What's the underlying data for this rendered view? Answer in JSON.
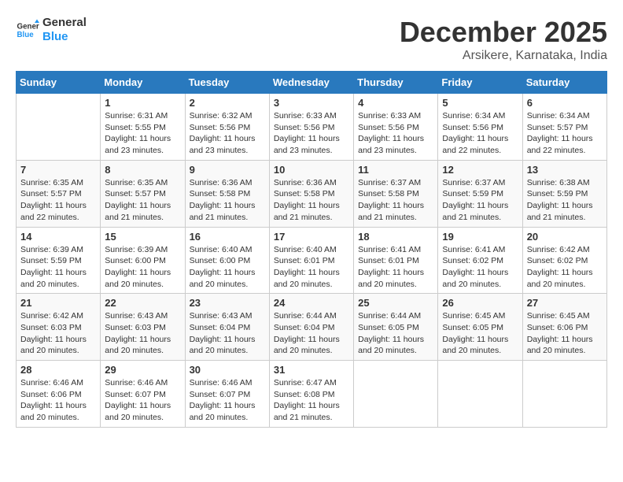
{
  "logo": {
    "line1": "General",
    "line2": "Blue"
  },
  "title": "December 2025",
  "subtitle": "Arsikere, Karnataka, India",
  "days_of_week": [
    "Sunday",
    "Monday",
    "Tuesday",
    "Wednesday",
    "Thursday",
    "Friday",
    "Saturday"
  ],
  "weeks": [
    [
      {
        "day": "",
        "info": ""
      },
      {
        "day": "1",
        "info": "Sunrise: 6:31 AM\nSunset: 5:55 PM\nDaylight: 11 hours\nand 23 minutes."
      },
      {
        "day": "2",
        "info": "Sunrise: 6:32 AM\nSunset: 5:56 PM\nDaylight: 11 hours\nand 23 minutes."
      },
      {
        "day": "3",
        "info": "Sunrise: 6:33 AM\nSunset: 5:56 PM\nDaylight: 11 hours\nand 23 minutes."
      },
      {
        "day": "4",
        "info": "Sunrise: 6:33 AM\nSunset: 5:56 PM\nDaylight: 11 hours\nand 23 minutes."
      },
      {
        "day": "5",
        "info": "Sunrise: 6:34 AM\nSunset: 5:56 PM\nDaylight: 11 hours\nand 22 minutes."
      },
      {
        "day": "6",
        "info": "Sunrise: 6:34 AM\nSunset: 5:57 PM\nDaylight: 11 hours\nand 22 minutes."
      }
    ],
    [
      {
        "day": "7",
        "info": "Sunrise: 6:35 AM\nSunset: 5:57 PM\nDaylight: 11 hours\nand 22 minutes."
      },
      {
        "day": "8",
        "info": "Sunrise: 6:35 AM\nSunset: 5:57 PM\nDaylight: 11 hours\nand 21 minutes."
      },
      {
        "day": "9",
        "info": "Sunrise: 6:36 AM\nSunset: 5:58 PM\nDaylight: 11 hours\nand 21 minutes."
      },
      {
        "day": "10",
        "info": "Sunrise: 6:36 AM\nSunset: 5:58 PM\nDaylight: 11 hours\nand 21 minutes."
      },
      {
        "day": "11",
        "info": "Sunrise: 6:37 AM\nSunset: 5:58 PM\nDaylight: 11 hours\nand 21 minutes."
      },
      {
        "day": "12",
        "info": "Sunrise: 6:37 AM\nSunset: 5:59 PM\nDaylight: 11 hours\nand 21 minutes."
      },
      {
        "day": "13",
        "info": "Sunrise: 6:38 AM\nSunset: 5:59 PM\nDaylight: 11 hours\nand 21 minutes."
      }
    ],
    [
      {
        "day": "14",
        "info": "Sunrise: 6:39 AM\nSunset: 5:59 PM\nDaylight: 11 hours\nand 20 minutes."
      },
      {
        "day": "15",
        "info": "Sunrise: 6:39 AM\nSunset: 6:00 PM\nDaylight: 11 hours\nand 20 minutes."
      },
      {
        "day": "16",
        "info": "Sunrise: 6:40 AM\nSunset: 6:00 PM\nDaylight: 11 hours\nand 20 minutes."
      },
      {
        "day": "17",
        "info": "Sunrise: 6:40 AM\nSunset: 6:01 PM\nDaylight: 11 hours\nand 20 minutes."
      },
      {
        "day": "18",
        "info": "Sunrise: 6:41 AM\nSunset: 6:01 PM\nDaylight: 11 hours\nand 20 minutes."
      },
      {
        "day": "19",
        "info": "Sunrise: 6:41 AM\nSunset: 6:02 PM\nDaylight: 11 hours\nand 20 minutes."
      },
      {
        "day": "20",
        "info": "Sunrise: 6:42 AM\nSunset: 6:02 PM\nDaylight: 11 hours\nand 20 minutes."
      }
    ],
    [
      {
        "day": "21",
        "info": "Sunrise: 6:42 AM\nSunset: 6:03 PM\nDaylight: 11 hours\nand 20 minutes."
      },
      {
        "day": "22",
        "info": "Sunrise: 6:43 AM\nSunset: 6:03 PM\nDaylight: 11 hours\nand 20 minutes."
      },
      {
        "day": "23",
        "info": "Sunrise: 6:43 AM\nSunset: 6:04 PM\nDaylight: 11 hours\nand 20 minutes."
      },
      {
        "day": "24",
        "info": "Sunrise: 6:44 AM\nSunset: 6:04 PM\nDaylight: 11 hours\nand 20 minutes."
      },
      {
        "day": "25",
        "info": "Sunrise: 6:44 AM\nSunset: 6:05 PM\nDaylight: 11 hours\nand 20 minutes."
      },
      {
        "day": "26",
        "info": "Sunrise: 6:45 AM\nSunset: 6:05 PM\nDaylight: 11 hours\nand 20 minutes."
      },
      {
        "day": "27",
        "info": "Sunrise: 6:45 AM\nSunset: 6:06 PM\nDaylight: 11 hours\nand 20 minutes."
      }
    ],
    [
      {
        "day": "28",
        "info": "Sunrise: 6:46 AM\nSunset: 6:06 PM\nDaylight: 11 hours\nand 20 minutes."
      },
      {
        "day": "29",
        "info": "Sunrise: 6:46 AM\nSunset: 6:07 PM\nDaylight: 11 hours\nand 20 minutes."
      },
      {
        "day": "30",
        "info": "Sunrise: 6:46 AM\nSunset: 6:07 PM\nDaylight: 11 hours\nand 20 minutes."
      },
      {
        "day": "31",
        "info": "Sunrise: 6:47 AM\nSunset: 6:08 PM\nDaylight: 11 hours\nand 21 minutes."
      },
      {
        "day": "",
        "info": ""
      },
      {
        "day": "",
        "info": ""
      },
      {
        "day": "",
        "info": ""
      }
    ]
  ]
}
